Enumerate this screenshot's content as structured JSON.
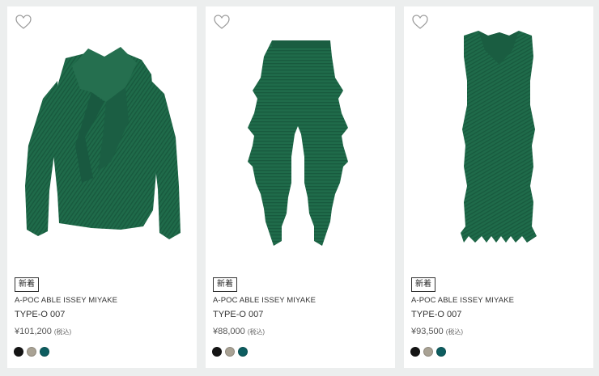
{
  "products": [
    {
      "badge": "新着",
      "brand": "A-POC ABLE ISSEY MIYAKE",
      "name": "TYPE-O 007",
      "price": "¥101,200",
      "tax_note": "(税込)",
      "garment": "jacket",
      "swatches": [
        "#141414",
        "#a9a294",
        "#0d5d60"
      ]
    },
    {
      "badge": "新着",
      "brand": "A-POC ABLE ISSEY MIYAKE",
      "name": "TYPE-O 007",
      "price": "¥88,000",
      "tax_note": "(税込)",
      "garment": "pants",
      "swatches": [
        "#141414",
        "#a9a294",
        "#0d5d60"
      ]
    },
    {
      "badge": "新着",
      "brand": "A-POC ABLE ISSEY MIYAKE",
      "name": "TYPE-O 007",
      "price": "¥93,500",
      "tax_note": "(税込)",
      "garment": "dress",
      "swatches": [
        "#141414",
        "#a9a294",
        "#0d5d60"
      ]
    }
  ],
  "icons": {
    "favorite": "heart-outline-icon"
  },
  "colors": {
    "garment_green": "#1f6b4a",
    "garment_shadow": "#164f37",
    "page_background": "#eceeee",
    "card_background": "#ffffff"
  }
}
